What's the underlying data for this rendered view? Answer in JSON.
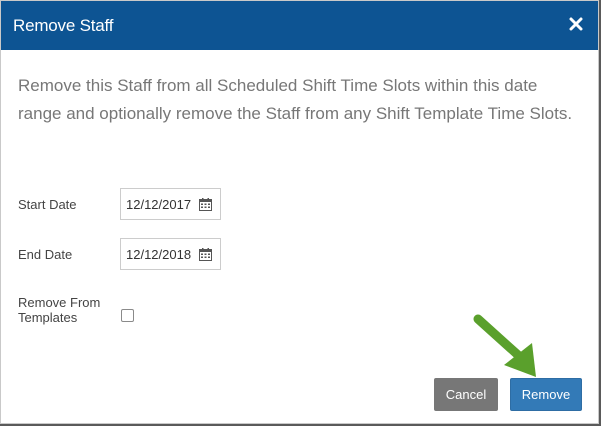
{
  "dialog": {
    "title": "Remove Staff",
    "close_icon": "close-icon",
    "description": "Remove this Staff from all Scheduled Shift Time Slots within this date range and optionally remove the Staff from any Shift Template Time Slots."
  },
  "form": {
    "start_date": {
      "label": "Start Date",
      "value": "12/12/2017",
      "icon": "calendar-icon"
    },
    "end_date": {
      "label": "End Date",
      "value": "12/12/2018",
      "icon": "calendar-icon"
    },
    "remove_from_templates": {
      "label": "Remove From Templates",
      "checked": false
    }
  },
  "footer": {
    "cancel_label": "Cancel",
    "remove_label": "Remove"
  },
  "annotation": {
    "arrow_icon": "green-arrow-icon",
    "arrow_color": "#5aa02c"
  },
  "colors": {
    "header_bg": "#0d5493",
    "primary_button": "#337ab7",
    "secondary_button": "#777777"
  }
}
